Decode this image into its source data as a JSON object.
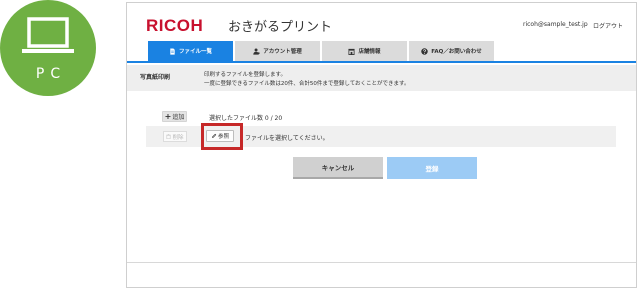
{
  "badge": {
    "label": "PC",
    "icon": "laptop-icon",
    "color": "#6fb043"
  },
  "header": {
    "logo": "RICOH",
    "app_title": "おきがるプリント",
    "user_email": "ricoh@sample_test.jp",
    "logout": "ログアウト"
  },
  "tabs": [
    {
      "label": "ファイル一覧",
      "icon": "document-icon",
      "active": true
    },
    {
      "label": "アカウント管理",
      "icon": "user-gear-icon",
      "active": false
    },
    {
      "label": "店舗情報",
      "icon": "store-icon",
      "active": false
    },
    {
      "label": "FAQ／お問い合わせ",
      "icon": "question-icon",
      "active": false
    }
  ],
  "info": {
    "section_label": "写真紙印刷",
    "line1": "印刷するファイルを登録します。",
    "line2": "一度に登録できるファイル数は20件、合計50件まで登録しておくことができます。"
  },
  "files": {
    "add_label": "追加",
    "count_text": "選択したファイル数 0 / 20",
    "delete_label": "削除",
    "browse_label": "参照",
    "hint": "ファイルを選択してください。"
  },
  "actions": {
    "cancel": "キャンセル",
    "submit": "登録"
  },
  "colors": {
    "brand": "#c8102e",
    "accent": "#1a82e2",
    "disabled_accent": "#9ccbf5",
    "highlight": "#c62828"
  }
}
